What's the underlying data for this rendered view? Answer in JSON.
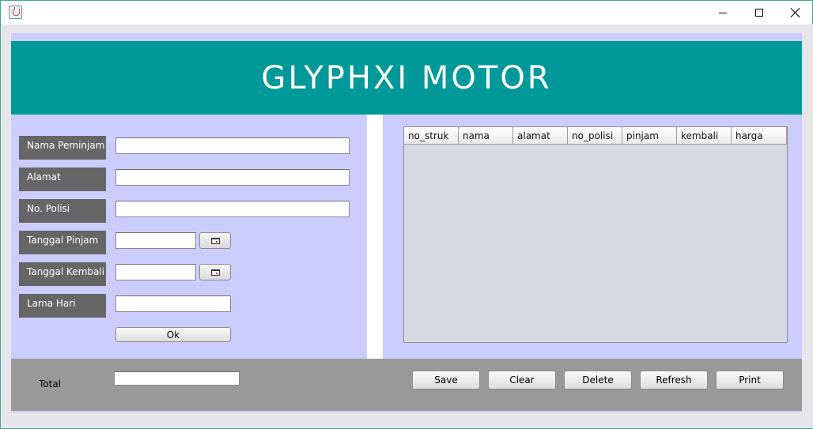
{
  "window": {
    "title": "",
    "controls": {
      "minimize_icon": "minimize-icon",
      "maximize_icon": "maximize-icon",
      "close_icon": "close-icon"
    }
  },
  "header": {
    "title": "GLYPHXI MOTOR",
    "bg_color": "#009999"
  },
  "form": {
    "nama_peminjam": {
      "label": "Nama Peminjam",
      "value": ""
    },
    "alamat": {
      "label": "Alamat",
      "value": ""
    },
    "no_polisi": {
      "label": "No. Polisi",
      "value": ""
    },
    "tanggal_pinjam": {
      "label": "Tanggal Pinjam",
      "value": "",
      "picker_icon": "calendar-icon"
    },
    "tanggal_kembali": {
      "label": "Tanggal Kembali",
      "value": "",
      "picker_icon": "calendar-icon"
    },
    "lama_hari": {
      "label": "Lama Hari",
      "value": ""
    },
    "ok_label": "Ok"
  },
  "table": {
    "columns": [
      "no_struk",
      "nama",
      "alamat",
      "no_polisi",
      "pinjam",
      "kembali",
      "harga"
    ],
    "rows": []
  },
  "footer": {
    "total_label": "Total",
    "total_value": "",
    "buttons": {
      "save": "Save",
      "clear": "Clear",
      "delete": "Delete",
      "refresh": "Refresh",
      "print": "Print"
    }
  },
  "colors": {
    "panel_bg": "#ccccff",
    "label_bg": "#666666",
    "footer_bg": "#999999",
    "table_bg": "#d6d9e0"
  }
}
